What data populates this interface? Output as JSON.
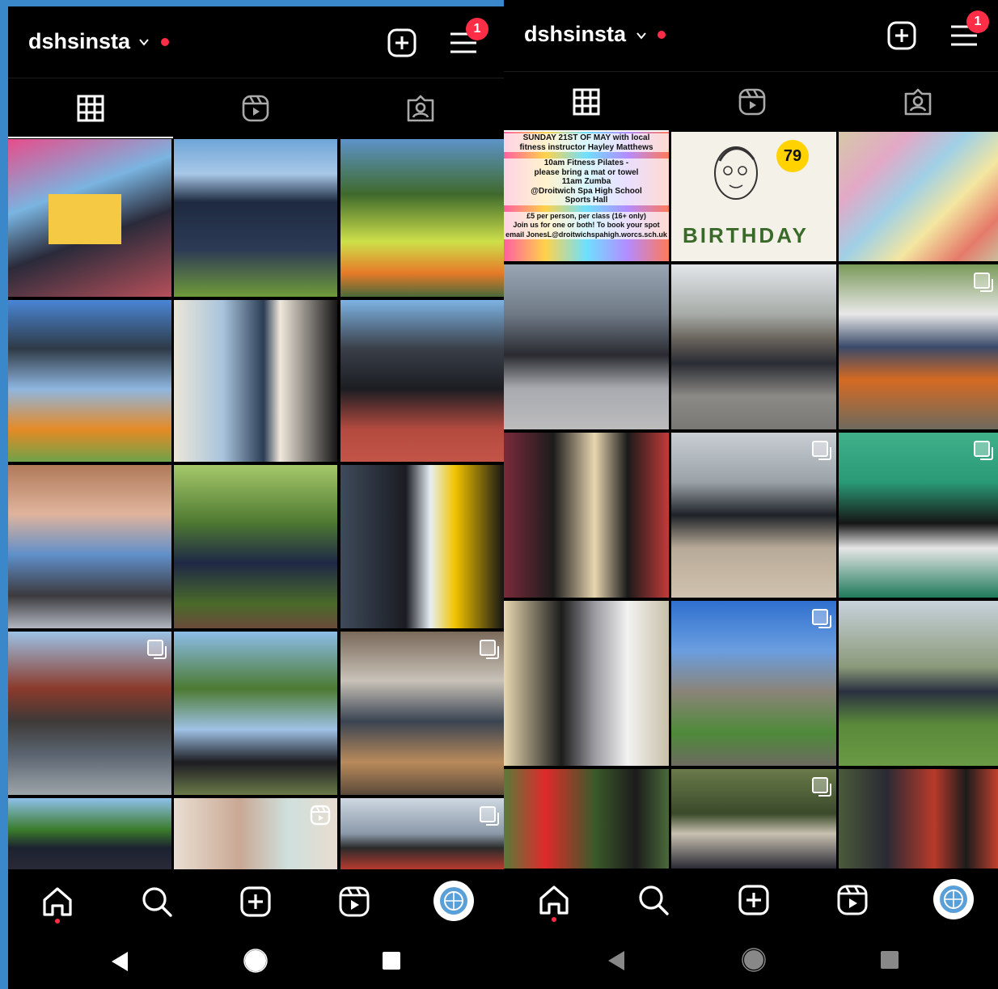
{
  "colors": {
    "accent_red": "#ff2d45",
    "background": "#000000",
    "frame": "#3a87c9"
  },
  "screens": [
    {
      "username": "dshsinsta",
      "notifications_badge": "1",
      "tabs": [
        "grid-icon",
        "reels-icon",
        "tagged-icon"
      ],
      "active_tab": "grid-icon",
      "posts": [
        {
          "caption": "",
          "multi": false
        },
        {
          "caption": "",
          "multi": false
        },
        {
          "caption": "",
          "multi": false
        },
        {
          "caption": "",
          "multi": false
        },
        {
          "caption": "",
          "multi": false
        },
        {
          "caption": "",
          "multi": false
        },
        {
          "caption": "",
          "multi": false
        },
        {
          "caption": "",
          "multi": false
        },
        {
          "caption": "",
          "multi": false
        },
        {
          "caption": "",
          "multi": true
        },
        {
          "caption": "",
          "multi": false
        },
        {
          "caption": "",
          "multi": true
        },
        {
          "caption": "",
          "multi": false
        },
        {
          "caption": "",
          "reel": true
        },
        {
          "caption": "",
          "multi": true
        }
      ],
      "bottom_nav": [
        "home-icon",
        "search-icon",
        "create-icon",
        "reels-icon",
        "profile-avatar"
      ],
      "system_nav": [
        "back-icon",
        "home-circle-icon",
        "recents-icon"
      ]
    },
    {
      "username": "dshsinsta",
      "notifications_badge": "1",
      "tabs": [
        "grid-icon",
        "reels-icon",
        "tagged-icon"
      ],
      "active_tab": "grid-icon",
      "poster_lines": [
        "SUNDAY 21ST OF MAY with local",
        "fitness instructor Hayley Matthews",
        "10am Fitness Pilates -",
        "please bring a mat or towel",
        "11am Zumba",
        "@Droitwich Spa High School",
        "Sports Hall",
        "£5 per person, per class (16+ only)",
        "Join us for one or both! To book your spot",
        "email JonesL@droitwichspahigh.worcs.sch.uk"
      ],
      "birthday_card": {
        "text": "BIRTHDAY",
        "number": "79"
      },
      "bottom_nav": [
        "home-icon",
        "search-icon",
        "create-icon",
        "reels-icon",
        "profile-avatar"
      ],
      "system_nav": [
        "back-icon",
        "home-circle-icon",
        "recents-icon"
      ]
    }
  ]
}
